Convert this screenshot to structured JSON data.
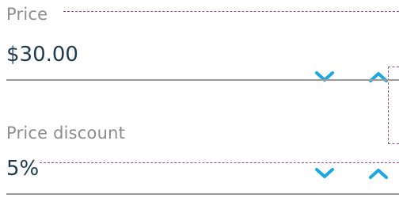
{
  "fields": [
    {
      "label": "Price",
      "value": "$30.00",
      "decrement_icon": "chevron-down-icon",
      "increment_icon": "chevron-up-icon"
    },
    {
      "label": "Price discount",
      "value": "5%",
      "decrement_icon": "chevron-down-icon",
      "increment_icon": "chevron-up-icon"
    }
  ],
  "colors": {
    "accent": "#19a7e6",
    "value_text": "#1b3a4f",
    "label_text": "#8d8d8d",
    "underline": "#9a9a9a",
    "guide": "#8e4b8e"
  }
}
